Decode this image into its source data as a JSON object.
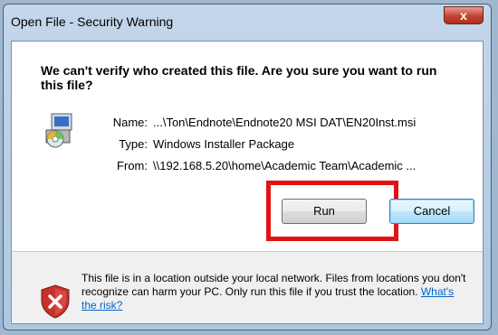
{
  "window": {
    "title": "Open File - Security Warning",
    "close_symbol": "x"
  },
  "prompt": {
    "heading": "We can't verify who created this file. Are you sure you want to run this file?"
  },
  "file": {
    "icon": "installer-package-icon",
    "rows": [
      {
        "label": "Name:",
        "value": "...\\Ton\\Endnote\\Endnote20 MSI DAT\\EN20Inst.msi"
      },
      {
        "label": "Type:",
        "value": "Windows Installer Package"
      },
      {
        "label": "From:",
        "value": "\\\\192.168.5.20\\home\\Academic Team\\Academic ..."
      }
    ]
  },
  "buttons": {
    "run": "Run",
    "cancel": "Cancel"
  },
  "footer": {
    "icon": "shield-warning-icon",
    "message": "This file is in a location outside your local network. Files from locations you don't recognize can harm your PC. Only run this file if you trust the location.",
    "link": "What's the risk?"
  },
  "colors": {
    "highlight": "#e01414",
    "link": "#0066cc"
  }
}
